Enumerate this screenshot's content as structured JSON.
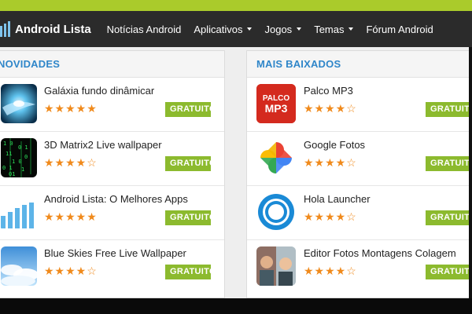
{
  "header": {
    "logo_text": "Android Lista",
    "nav": [
      {
        "label": "Notícias Android",
        "dropdown": false
      },
      {
        "label": "Aplicativos",
        "dropdown": true
      },
      {
        "label": "Jogos",
        "dropdown": true
      },
      {
        "label": "Temas",
        "dropdown": true
      },
      {
        "label": "Fórum Android",
        "dropdown": false
      }
    ]
  },
  "colors": {
    "accent_green": "#8cba2e",
    "top_strip": "#aacb2b",
    "navbar": "#2b2b2b",
    "section_title": "#2f86c9",
    "star": "#f08a1c"
  },
  "novidades": {
    "title": "NOVIDADES",
    "items": [
      {
        "name": "Galáxia fundo dinâmicar",
        "rating": 5,
        "badge": "GRATUITO",
        "icon": "galaxy-swirl-icon"
      },
      {
        "name": "3D Matrix2 Live wallpaper",
        "rating": 4,
        "badge": "GRATUITO",
        "icon": "matrix-icon"
      },
      {
        "name": "Android Lista: O Melhores Apps",
        "rating": 5,
        "badge": "GRATUITO",
        "icon": "android-lista-bars-icon"
      },
      {
        "name": "Blue Skies Free Live Wallpaper",
        "rating": 4,
        "badge": "GRATUITO",
        "icon": "blue-sky-icon"
      }
    ]
  },
  "mais_baixados": {
    "title": "MAIS BAIXADOS",
    "items": [
      {
        "name": "Palco MP3",
        "rating": 4,
        "badge": "GRATUITO",
        "icon": "palco-mp3-icon",
        "icon_text_1": "PALCO",
        "icon_text_2": "MP3"
      },
      {
        "name": "Google Fotos",
        "rating": 4,
        "badge": "GRATUITO",
        "icon": "google-photos-pinwheel-icon"
      },
      {
        "name": "Hola Launcher",
        "rating": 4,
        "badge": "GRATUITO",
        "icon": "hola-launcher-ring-icon"
      },
      {
        "name": "Editor Fotos Montagens Colagem",
        "rating": 4,
        "badge": "GRATUITO",
        "icon": "photo-collage-icon"
      }
    ]
  }
}
